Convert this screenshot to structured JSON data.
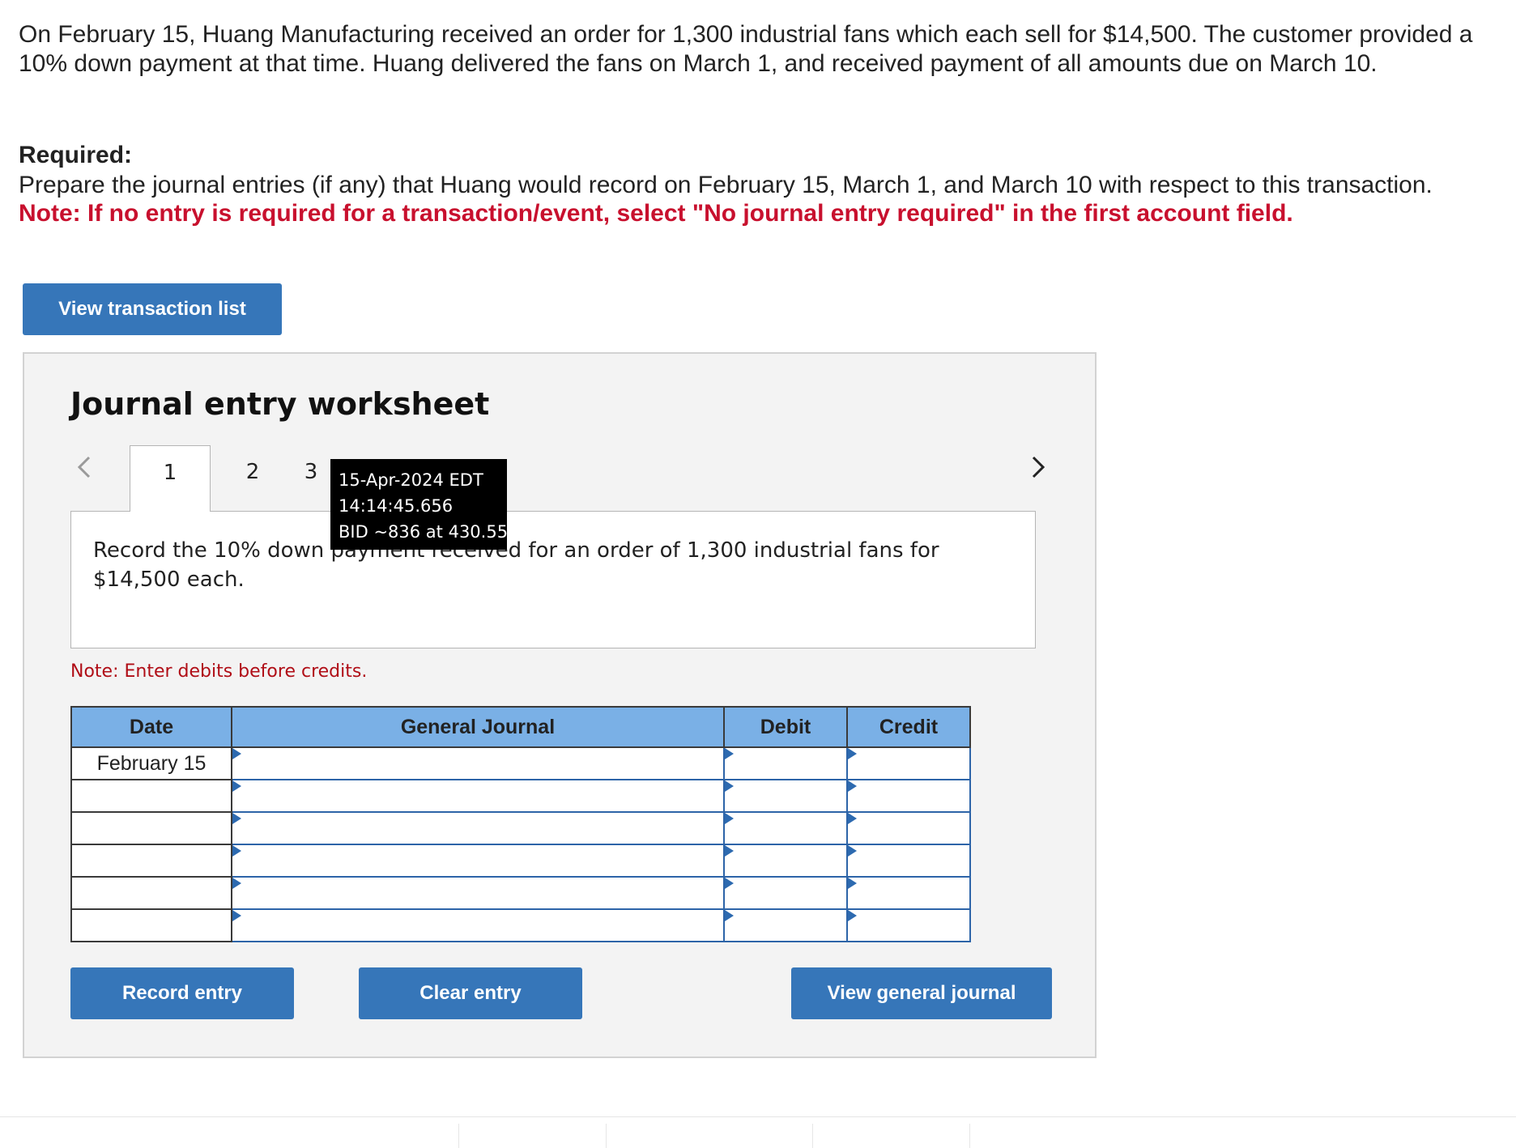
{
  "problem": {
    "text": "On February 15, Huang Manufacturing received an order for 1,300 industrial fans which each sell for $14,500. The customer provided a 10% down payment at that time. Huang delivered the fans on March 1, and received payment of all amounts due on March 10."
  },
  "required": {
    "heading": "Required:",
    "text": "Prepare the journal entries (if any) that Huang would record on February 15, March 1, and March 10 with respect to this transaction.",
    "note": "Note: If no entry is required for a transaction/event, select \"No journal entry required\" in the first account field."
  },
  "buttons": {
    "view_transaction_list": "View transaction list",
    "record_entry": "Record entry",
    "clear_entry": "Clear entry",
    "view_general_journal": "View general journal"
  },
  "worksheet": {
    "title": "Journal entry worksheet",
    "tabs": [
      {
        "label": "1",
        "active": true
      },
      {
        "label": "2",
        "active": false
      },
      {
        "label": "3",
        "active": false
      }
    ],
    "instruction": "Record the 10% down payment received for an order of 1,300 industrial fans for $14,500 each.",
    "note": "Note: Enter debits before credits."
  },
  "tooltip": {
    "line1": "15-Apr-2024 EDT",
    "line2": "14:14:45.656",
    "line3": "BID ~836 at 430.55"
  },
  "journal": {
    "columns": {
      "date": "Date",
      "general_journal": "General Journal",
      "debit": "Debit",
      "credit": "Credit"
    },
    "rows": [
      {
        "date": "February 15",
        "account": "",
        "debit": "",
        "credit": ""
      },
      {
        "date": "",
        "account": "",
        "debit": "",
        "credit": ""
      },
      {
        "date": "",
        "account": "",
        "debit": "",
        "credit": ""
      },
      {
        "date": "",
        "account": "",
        "debit": "",
        "credit": ""
      },
      {
        "date": "",
        "account": "",
        "debit": "",
        "credit": ""
      },
      {
        "date": "",
        "account": "",
        "debit": "",
        "credit": ""
      }
    ]
  },
  "colors": {
    "button": "#3676b9",
    "header": "#7ab0e6",
    "note_red": "#c8102e"
  }
}
